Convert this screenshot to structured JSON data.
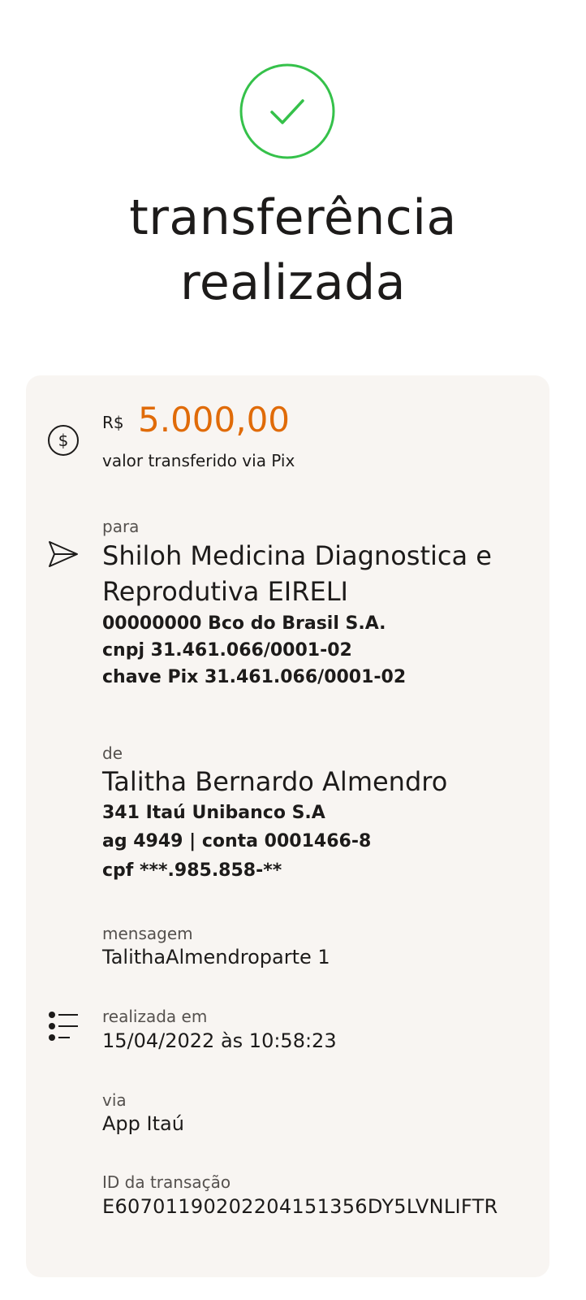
{
  "status": {
    "title_line1": "transferência",
    "title_line2": "realizada",
    "success_color": "#35c14a",
    "icon": "check-icon"
  },
  "amount": {
    "currency": "R$",
    "value": "5.000,00",
    "label": "valor transferido via Pix",
    "color": "#e06b08",
    "icon": "dollar-circle-icon"
  },
  "recipient": {
    "label": "para",
    "name_line1": "Shiloh Medicina Diagnostica e",
    "name_line2": "Reprodutiva EIRELI",
    "bank": "00000000 Bco do Brasil S.A.",
    "cnpj": "cnpj 31.461.066/0001-02",
    "pix_key": "chave Pix 31.461.066/0001-02",
    "icon": "send-icon"
  },
  "sender": {
    "label": "de",
    "name": "Talitha Bernardo Almendro",
    "bank": "341 Itaú Unibanco S.A",
    "account": "ag 4949 | conta 0001466-8",
    "cpf": "cpf ***.985.858-**"
  },
  "message": {
    "label": "mensagem",
    "value": "TalithaAlmendroparte 1"
  },
  "details": {
    "icon": "list-icon",
    "date_label": "realizada em",
    "date_value": "15/04/2022 às 10:58:23",
    "via_label": "via",
    "via_value": "App Itaú",
    "id_label": "ID da transação",
    "id_value": "E60701190202204151356DY5LVNLIFTR"
  }
}
